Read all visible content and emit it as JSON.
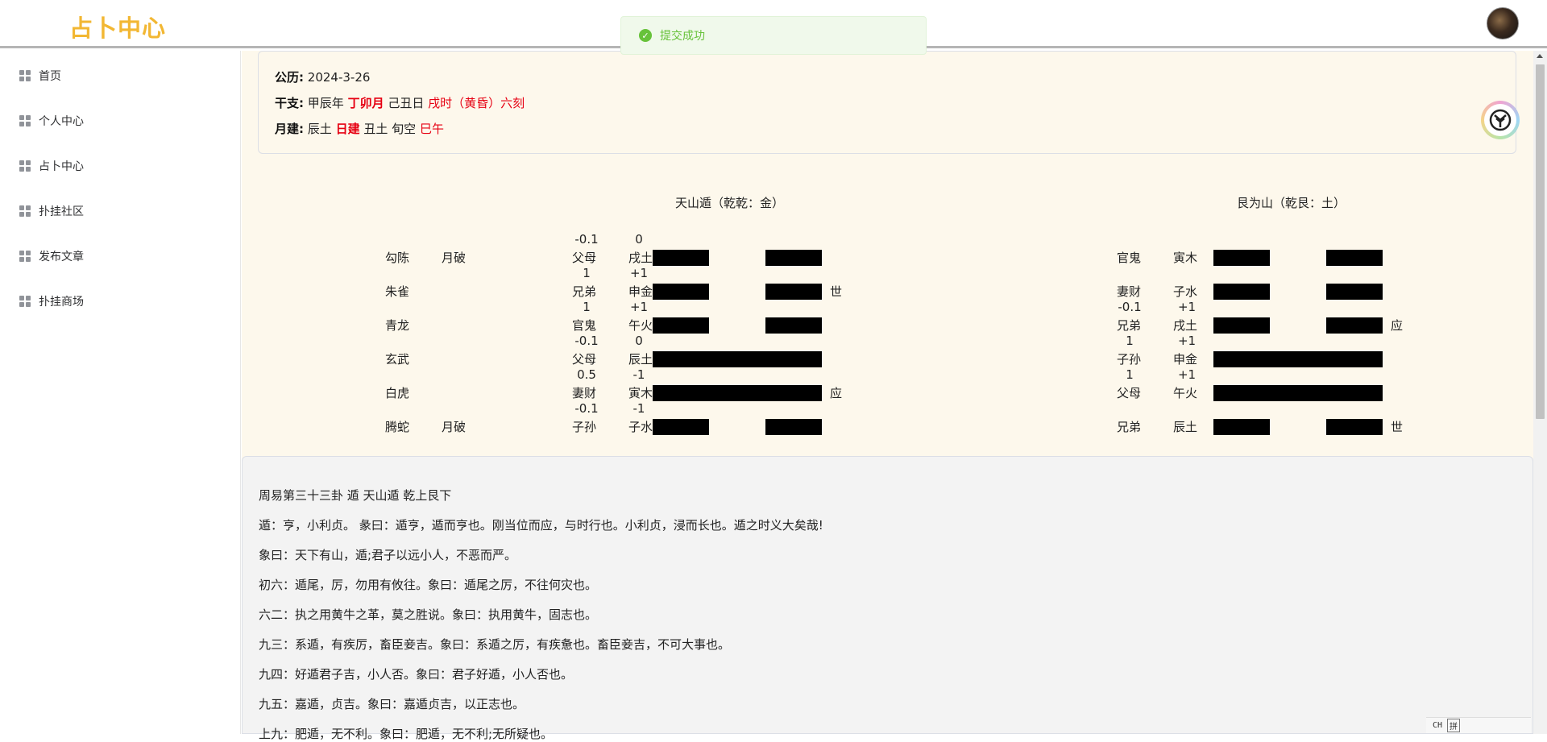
{
  "header": {
    "logo": "占卜中心",
    "toast": "提交成功"
  },
  "sidebar": {
    "items": [
      {
        "label": "首页"
      },
      {
        "label": "个人中心"
      },
      {
        "label": "占卜中心"
      },
      {
        "label": "扑挂社区"
      },
      {
        "label": "发布文章"
      },
      {
        "label": "扑挂商场"
      }
    ]
  },
  "info": {
    "solar_label": "公历:",
    "solar_value": "2024-3-26",
    "ganzhi_label": "干支:",
    "ganzhi_year": "甲辰年",
    "ganzhi_month": "丁卯月",
    "ganzhi_day": "己丑日",
    "ganzhi_time": "戌时（黄昏）六刻",
    "yuejian_label": "月建:",
    "yuejian_a": "辰土",
    "yuejian_b": "日建",
    "yuejian_c": "丑土",
    "yuejian_d": "旬空",
    "yuejian_e": "巳午"
  },
  "hex_left": {
    "title": "天山遁（乾乾：金）",
    "lines": [
      {
        "shen": "勾陈",
        "status": "月破",
        "score_a": "-0.1",
        "score_b": "0",
        "relation": "父母",
        "branch": "戌土",
        "yin": true,
        "mark": ""
      },
      {
        "shen": "朱雀",
        "status": "",
        "score_a": "1",
        "score_b": "+1",
        "relation": "兄弟",
        "branch": "申金",
        "yin": true,
        "mark": "世"
      },
      {
        "shen": "青龙",
        "status": "",
        "score_a": "1",
        "score_b": "+1",
        "relation": "官鬼",
        "branch": "午火",
        "yin": true,
        "mark": ""
      },
      {
        "shen": "玄武",
        "status": "",
        "score_a": "-0.1",
        "score_b": "0",
        "relation": "父母",
        "branch": "辰土",
        "yin": false,
        "mark": ""
      },
      {
        "shen": "白虎",
        "status": "",
        "score_a": "0.5",
        "score_b": "-1",
        "relation": "妻财",
        "branch": "寅木",
        "yin": false,
        "mark": "应"
      },
      {
        "shen": "腾蛇",
        "status": "月破",
        "score_a": "-0.1",
        "score_b": "-1",
        "relation": "子孙",
        "branch": "子水",
        "yin": true,
        "mark": ""
      }
    ]
  },
  "hex_right": {
    "title": "艮为山（乾艮：土）",
    "lines": [
      {
        "score_a": "",
        "score_b": "",
        "relation": "官鬼",
        "branch": "寅木",
        "yin": true,
        "mark": ""
      },
      {
        "score_a": "",
        "score_b": "",
        "relation": "妻财",
        "branch": "子水",
        "yin": true,
        "mark": ""
      },
      {
        "score_a": "-0.1",
        "score_b": "+1",
        "relation": "兄弟",
        "branch": "戌土",
        "yin": true,
        "mark": "应"
      },
      {
        "score_a": "1",
        "score_b": "+1",
        "relation": "子孙",
        "branch": "申金",
        "yin": false,
        "mark": ""
      },
      {
        "score_a": "1",
        "score_b": "+1",
        "relation": "父母",
        "branch": "午火",
        "yin": false,
        "mark": ""
      },
      {
        "score_a": "",
        "score_b": "",
        "relation": "兄弟",
        "branch": "辰土",
        "yin": true,
        "mark": "世"
      }
    ]
  },
  "text": {
    "paragraphs": [
      "周易第三十三卦 遁 天山遁 乾上艮下",
      "遁：亨，小利贞。 彖曰：遁亨，遁而亨也。刚当位而应，与时行也。小利贞，浸而长也。遁之时义大矣哉!",
      "象曰：天下有山，遁;君子以远小人，不恶而严。",
      "初六：遁尾，厉，勿用有攸往。象曰：遁尾之厉，不往何灾也。",
      "六二：执之用黄牛之革，莫之胜说。象曰：执用黄牛，固志也。",
      "九三：系遁，有疾厉，畜臣妾吉。象曰：系遁之厉，有疾惫也。畜臣妾吉，不可大事也。",
      "九四：好遁君子吉，小人否。象曰：君子好遁，小人否也。",
      "九五：嘉遁，贞吉。象曰：嘉遁贞吉，以正志也。",
      "上九：肥遁，无不利。象曰：肥遁，无不利;无所疑也。"
    ]
  },
  "ime": {
    "lang": "CH",
    "mode": "拼"
  }
}
